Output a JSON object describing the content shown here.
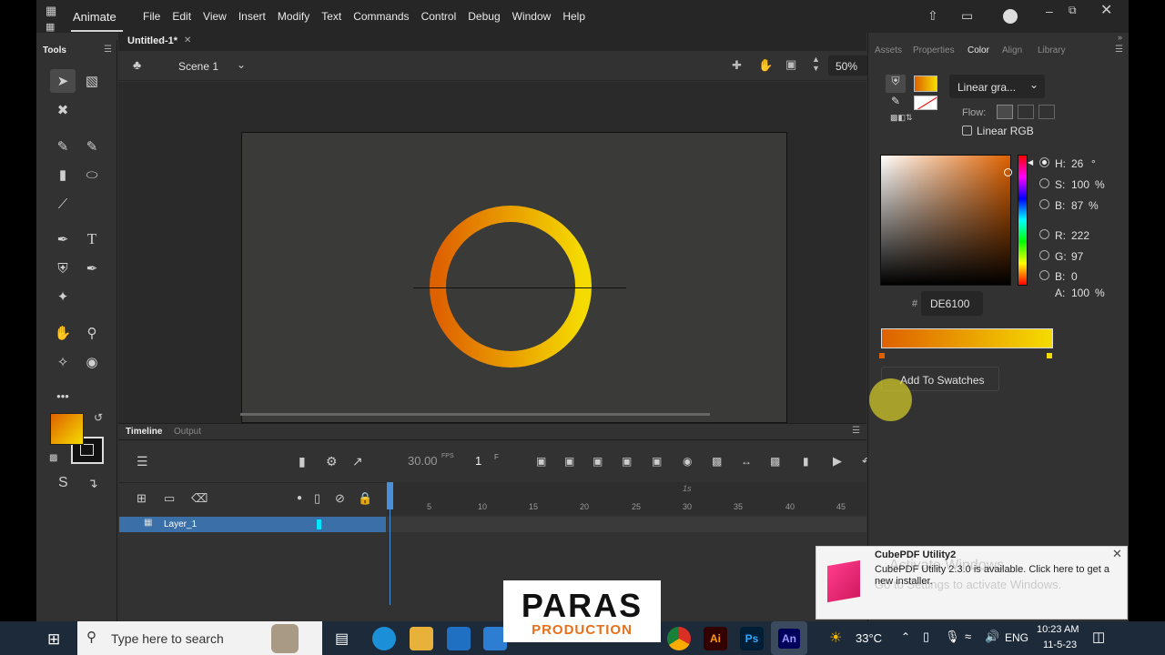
{
  "app": {
    "name": "Animate"
  },
  "menu": [
    "File",
    "Edit",
    "View",
    "Insert",
    "Modify",
    "Text",
    "Commands",
    "Control",
    "Debug",
    "Window",
    "Help"
  ],
  "tools_title": "Tools",
  "document": {
    "tab": "Untitled-1*",
    "scene": "Scene 1",
    "zoom": "50%"
  },
  "timeline": {
    "tabs": [
      "Timeline",
      "Output"
    ],
    "fps": "30.00",
    "fps_unit": "FPS",
    "frame": "1",
    "frame_unit": "F",
    "second_marker": "1s",
    "ruler": [
      "5",
      "10",
      "15",
      "20",
      "25",
      "30",
      "35",
      "40",
      "45"
    ],
    "layer": "Layer_1"
  },
  "panel": {
    "tabs": [
      "Assets",
      "Properties",
      "Color",
      "Align",
      "Library"
    ],
    "active_tab": "Color",
    "fill_type": "Linear gra...",
    "flow_label": "Flow:",
    "linear_rgb": "Linear RGB",
    "hsb": [
      {
        "label": "H:",
        "value": "26",
        "unit": "°"
      },
      {
        "label": "S:",
        "value": "100",
        "unit": "%"
      },
      {
        "label": "B:",
        "value": "87",
        "unit": "%"
      }
    ],
    "rgb": [
      {
        "label": "R:",
        "value": "222"
      },
      {
        "label": "G:",
        "value": "97"
      },
      {
        "label": "B:",
        "value": "0"
      }
    ],
    "alpha": {
      "label": "A:",
      "value": "100",
      "unit": "%"
    },
    "hex_prefix": "#",
    "hex": "DE6100",
    "add_swatches": "Add To Swatches"
  },
  "colors": {
    "gradient_start": "#DE6100",
    "gradient_end": "#F5DC00",
    "accent": "#4A90D9"
  },
  "toast": {
    "title": "CubePDF Utility2",
    "body": "CubePDF Utility 2.3.0 is available. Click here to get a new installer.",
    "watermark_title": "Activate Windows",
    "watermark_body": "Go to Settings to activate Windows."
  },
  "logo": {
    "line1": "PARAS",
    "line2": "PRODUCTION"
  },
  "taskbar": {
    "search_placeholder": "Type here to search",
    "weather": "33°C",
    "lang": "ENG",
    "time": "10:23 AM",
    "date": "11-5-23"
  }
}
